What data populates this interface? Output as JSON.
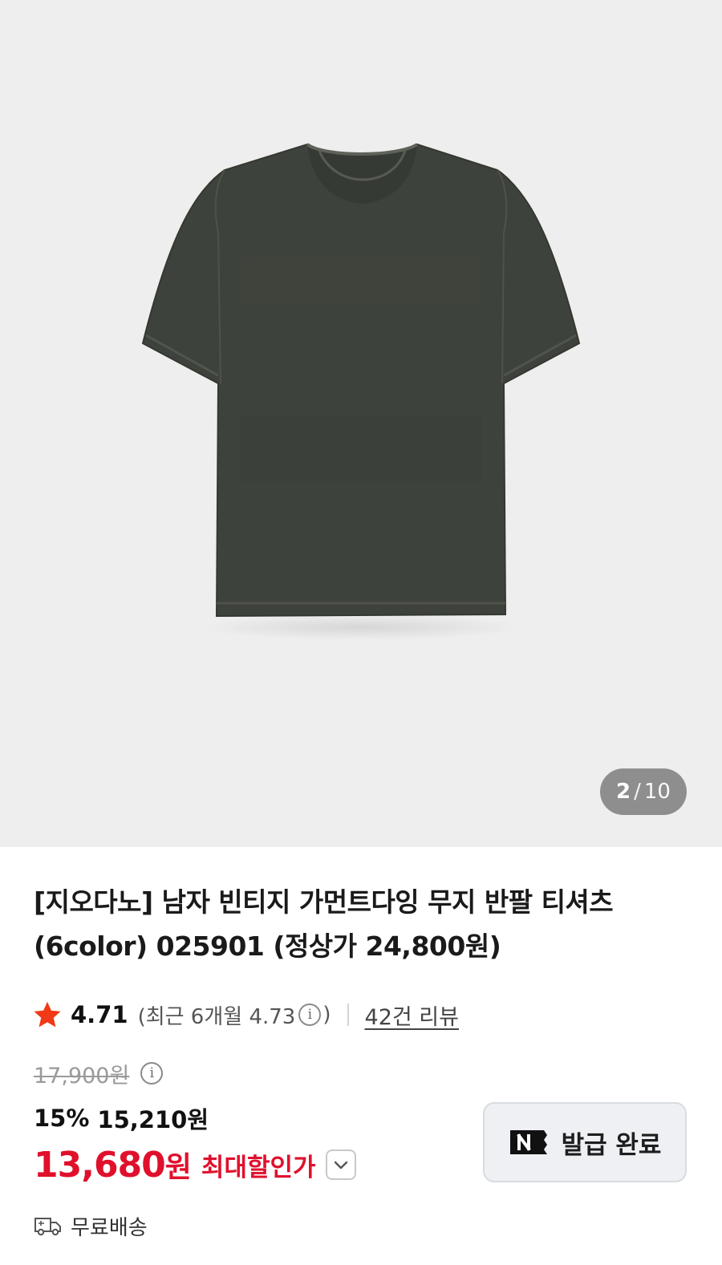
{
  "gallery": {
    "current_index": "2",
    "separator": "/",
    "total": "10",
    "background_color": "#eeeeee",
    "product_color": "#3e423c"
  },
  "product": {
    "title": "[지오다노] 남자 빈티지 가먼트다잉 무지 반팔 티셔츠 (6color) 025901 (정상가 24,800원)"
  },
  "rating": {
    "icon": "star-icon",
    "score": "4.71",
    "recent_open": "(최근 6개월 4.73",
    "recent_close": ")",
    "info_icon": "info-icon",
    "reviews_link": "42건 리뷰"
  },
  "price": {
    "original": "17,900원",
    "discount_percent": "15%",
    "sale_price": "15,210원",
    "final_amount": "13,680",
    "final_unit": "원",
    "final_label": "최대할인가",
    "accent_color": "#e0102c"
  },
  "coupon": {
    "icon": "naver-n-icon",
    "label": "발급 완료"
  },
  "shipping": {
    "icon": "truck-icon",
    "label": "무료배송"
  }
}
